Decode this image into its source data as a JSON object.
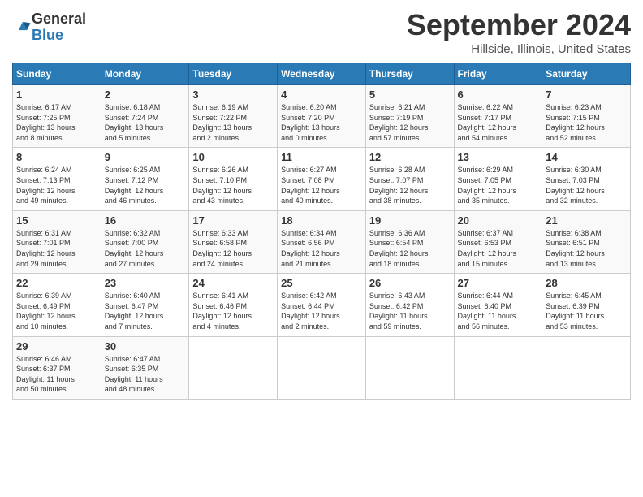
{
  "logo": {
    "general": "General",
    "blue": "Blue"
  },
  "header": {
    "month": "September 2024",
    "location": "Hillside, Illinois, United States"
  },
  "columns": [
    "Sunday",
    "Monday",
    "Tuesday",
    "Wednesday",
    "Thursday",
    "Friday",
    "Saturday"
  ],
  "weeks": [
    [
      {
        "day": "1",
        "info": "Sunrise: 6:17 AM\nSunset: 7:25 PM\nDaylight: 13 hours\nand 8 minutes."
      },
      {
        "day": "2",
        "info": "Sunrise: 6:18 AM\nSunset: 7:24 PM\nDaylight: 13 hours\nand 5 minutes."
      },
      {
        "day": "3",
        "info": "Sunrise: 6:19 AM\nSunset: 7:22 PM\nDaylight: 13 hours\nand 2 minutes."
      },
      {
        "day": "4",
        "info": "Sunrise: 6:20 AM\nSunset: 7:20 PM\nDaylight: 13 hours\nand 0 minutes."
      },
      {
        "day": "5",
        "info": "Sunrise: 6:21 AM\nSunset: 7:19 PM\nDaylight: 12 hours\nand 57 minutes."
      },
      {
        "day": "6",
        "info": "Sunrise: 6:22 AM\nSunset: 7:17 PM\nDaylight: 12 hours\nand 54 minutes."
      },
      {
        "day": "7",
        "info": "Sunrise: 6:23 AM\nSunset: 7:15 PM\nDaylight: 12 hours\nand 52 minutes."
      }
    ],
    [
      {
        "day": "8",
        "info": "Sunrise: 6:24 AM\nSunset: 7:13 PM\nDaylight: 12 hours\nand 49 minutes."
      },
      {
        "day": "9",
        "info": "Sunrise: 6:25 AM\nSunset: 7:12 PM\nDaylight: 12 hours\nand 46 minutes."
      },
      {
        "day": "10",
        "info": "Sunrise: 6:26 AM\nSunset: 7:10 PM\nDaylight: 12 hours\nand 43 minutes."
      },
      {
        "day": "11",
        "info": "Sunrise: 6:27 AM\nSunset: 7:08 PM\nDaylight: 12 hours\nand 40 minutes."
      },
      {
        "day": "12",
        "info": "Sunrise: 6:28 AM\nSunset: 7:07 PM\nDaylight: 12 hours\nand 38 minutes."
      },
      {
        "day": "13",
        "info": "Sunrise: 6:29 AM\nSunset: 7:05 PM\nDaylight: 12 hours\nand 35 minutes."
      },
      {
        "day": "14",
        "info": "Sunrise: 6:30 AM\nSunset: 7:03 PM\nDaylight: 12 hours\nand 32 minutes."
      }
    ],
    [
      {
        "day": "15",
        "info": "Sunrise: 6:31 AM\nSunset: 7:01 PM\nDaylight: 12 hours\nand 29 minutes."
      },
      {
        "day": "16",
        "info": "Sunrise: 6:32 AM\nSunset: 7:00 PM\nDaylight: 12 hours\nand 27 minutes."
      },
      {
        "day": "17",
        "info": "Sunrise: 6:33 AM\nSunset: 6:58 PM\nDaylight: 12 hours\nand 24 minutes."
      },
      {
        "day": "18",
        "info": "Sunrise: 6:34 AM\nSunset: 6:56 PM\nDaylight: 12 hours\nand 21 minutes."
      },
      {
        "day": "19",
        "info": "Sunrise: 6:36 AM\nSunset: 6:54 PM\nDaylight: 12 hours\nand 18 minutes."
      },
      {
        "day": "20",
        "info": "Sunrise: 6:37 AM\nSunset: 6:53 PM\nDaylight: 12 hours\nand 15 minutes."
      },
      {
        "day": "21",
        "info": "Sunrise: 6:38 AM\nSunset: 6:51 PM\nDaylight: 12 hours\nand 13 minutes."
      }
    ],
    [
      {
        "day": "22",
        "info": "Sunrise: 6:39 AM\nSunset: 6:49 PM\nDaylight: 12 hours\nand 10 minutes."
      },
      {
        "day": "23",
        "info": "Sunrise: 6:40 AM\nSunset: 6:47 PM\nDaylight: 12 hours\nand 7 minutes."
      },
      {
        "day": "24",
        "info": "Sunrise: 6:41 AM\nSunset: 6:46 PM\nDaylight: 12 hours\nand 4 minutes."
      },
      {
        "day": "25",
        "info": "Sunrise: 6:42 AM\nSunset: 6:44 PM\nDaylight: 12 hours\nand 2 minutes."
      },
      {
        "day": "26",
        "info": "Sunrise: 6:43 AM\nSunset: 6:42 PM\nDaylight: 11 hours\nand 59 minutes."
      },
      {
        "day": "27",
        "info": "Sunrise: 6:44 AM\nSunset: 6:40 PM\nDaylight: 11 hours\nand 56 minutes."
      },
      {
        "day": "28",
        "info": "Sunrise: 6:45 AM\nSunset: 6:39 PM\nDaylight: 11 hours\nand 53 minutes."
      }
    ],
    [
      {
        "day": "29",
        "info": "Sunrise: 6:46 AM\nSunset: 6:37 PM\nDaylight: 11 hours\nand 50 minutes."
      },
      {
        "day": "30",
        "info": "Sunrise: 6:47 AM\nSunset: 6:35 PM\nDaylight: 11 hours\nand 48 minutes."
      },
      null,
      null,
      null,
      null,
      null
    ]
  ]
}
